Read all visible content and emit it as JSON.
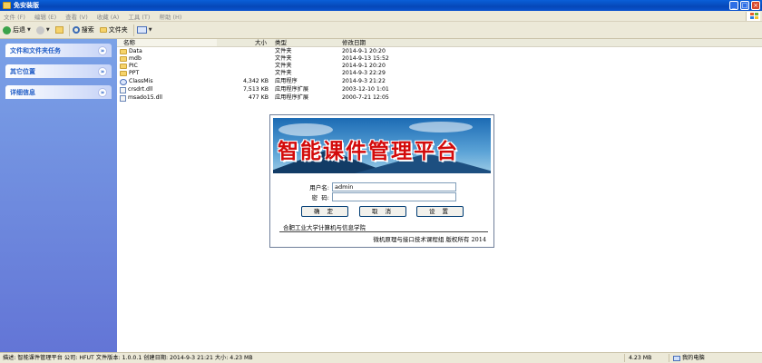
{
  "window": {
    "title": "免安装版"
  },
  "menu": [
    "文件 (F)",
    "编辑 (E)",
    "查看 (V)",
    "收藏 (A)",
    "工具 (T)",
    "帮助 (H)"
  ],
  "toolbar": {
    "back": "后退",
    "search": "搜索",
    "folders": "文件夹"
  },
  "tasks": [
    {
      "label": "文件和文件夹任务"
    },
    {
      "label": "其它位置"
    },
    {
      "label": "详细信息"
    }
  ],
  "columns": {
    "name": "名称",
    "size": "大小",
    "type": "类型",
    "date": "修改日期"
  },
  "files": [
    {
      "name": "Data",
      "size": "",
      "type": "文件夹",
      "date": "2014-9-1 20:20",
      "icon": "folder-icon"
    },
    {
      "name": "mdb",
      "size": "",
      "type": "文件夹",
      "date": "2014-9-13 15:52",
      "icon": "folder-icon"
    },
    {
      "name": "PIC",
      "size": "",
      "type": "文件夹",
      "date": "2014-9-1 20:20",
      "icon": "folder-icon"
    },
    {
      "name": "PPT",
      "size": "",
      "type": "文件夹",
      "date": "2014-9-3 22:29",
      "icon": "folder-icon"
    },
    {
      "name": "ClassMis",
      "size": "4,342 KB",
      "type": "应用程序",
      "date": "2014-9-3 21:22",
      "icon": "app-icon"
    },
    {
      "name": "crsdrt.dll",
      "size": "7,513 KB",
      "type": "应用程序扩展",
      "date": "2003-12-10 1:01",
      "icon": "dll-icon"
    },
    {
      "name": "msado15.dll",
      "size": "477 KB",
      "type": "应用程序扩展",
      "date": "2000-7-21 12:05",
      "icon": "dll-icon"
    }
  ],
  "splash": {
    "banner_title": "智能课件管理平台",
    "user_label": "用户名:",
    "user_value": "admin",
    "pwd_label": "密  码:",
    "pwd_value": "",
    "ok": "确 定",
    "cancel": "取 消",
    "settings": "设 置",
    "org": "合肥工业大学计算机与信息学院",
    "copyright": "微机原理与接口技术课程组 版权所有 2014"
  },
  "status": {
    "description": "描述: 智能课件管理平台 公司: HFUT 文件版本: 1.0.0.1 创建日期: 2014-9-3 21:21 大小: 4.23 MB",
    "size": "4.23 MB",
    "location": "我的电脑"
  },
  "colors": {
    "title_bar": "#0a5fd8",
    "task_pane": "#7ba2e7",
    "banner_text": "#d30b0b"
  }
}
